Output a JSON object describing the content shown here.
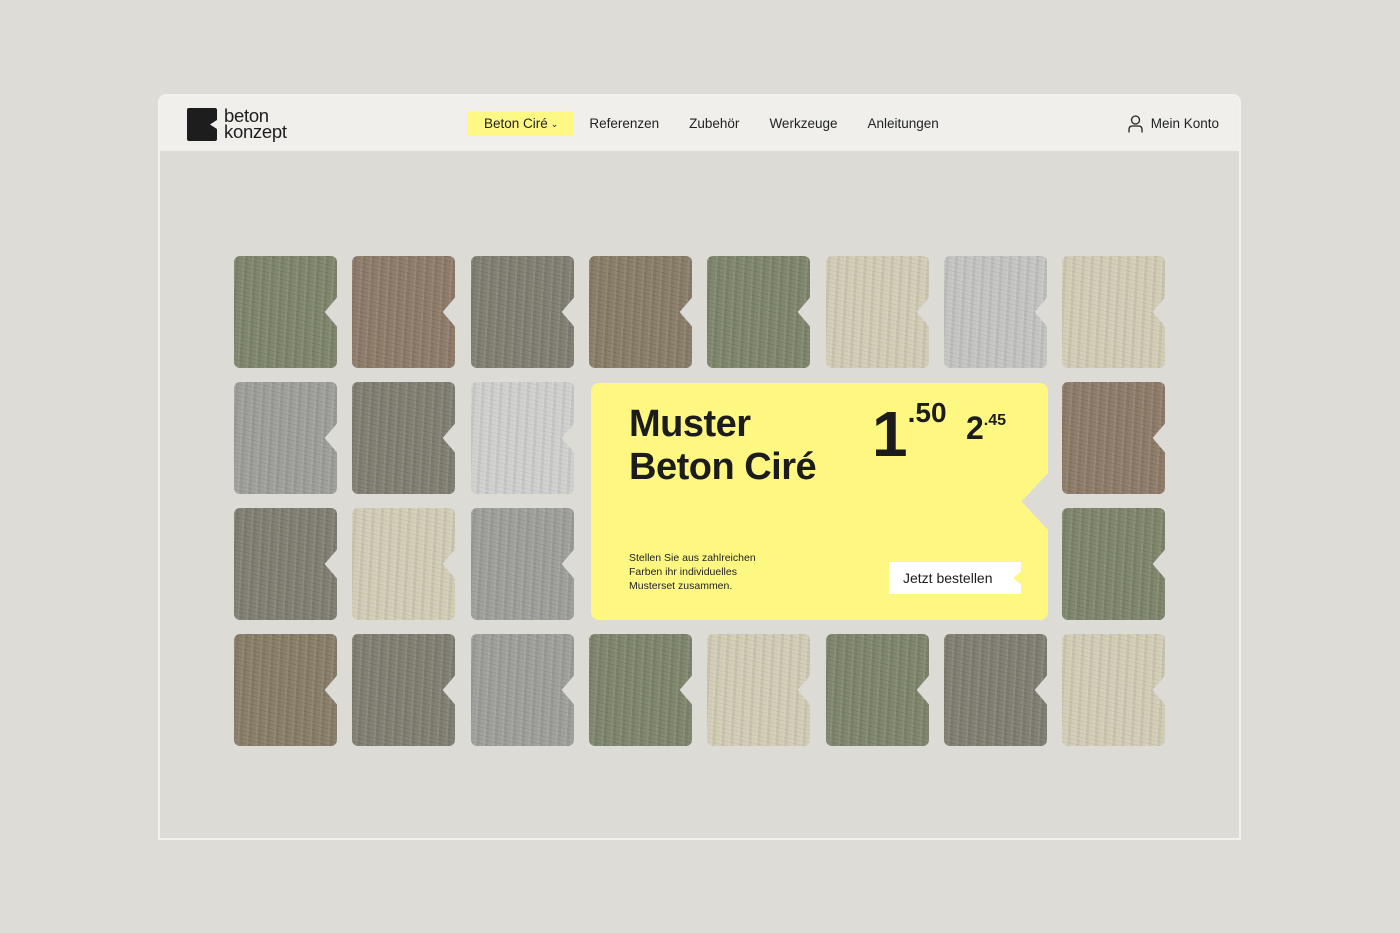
{
  "logo": {
    "line1": "beton",
    "line2": "konzept"
  },
  "nav": {
    "items": [
      {
        "label": "Beton Ciré",
        "active": true,
        "dropdown": true
      },
      {
        "label": "Referenzen"
      },
      {
        "label": "Zubehör"
      },
      {
        "label": "Werkzeuge"
      },
      {
        "label": "Anleitungen"
      }
    ],
    "account_label": "Mein Konto"
  },
  "promo": {
    "title_line1": "Muster",
    "title_line2": "Beton Ciré",
    "price_main_int": "1",
    "price_main_dec": ".50",
    "price_alt_int": "2",
    "price_alt_dec": ".45",
    "description_line1": "Stellen Sie aus zahlreichen",
    "description_line2": "Farben ihr individuelles",
    "description_line3": "Musterset zusammen.",
    "button_label": "Jetzt bestellen"
  },
  "swatches": [
    [
      "olive-green",
      "taupe-brown",
      "warm-grey",
      "khaki-brown",
      "olive-green",
      "sand-beige",
      "light-grey",
      "sand-beige"
    ],
    [
      "mid-grey",
      "warm-grey",
      "white-grey",
      null,
      null,
      null,
      null,
      "taupe-brown"
    ],
    [
      "warm-grey",
      "sand-beige",
      "mid-grey",
      null,
      null,
      null,
      null,
      "olive-green"
    ],
    [
      "khaki-brown",
      "warm-grey",
      "mid-grey",
      "olive-green",
      "sand-beige",
      "olive-green",
      "warm-grey",
      "sand-beige"
    ]
  ],
  "swatch_colors": {
    "olive-green": "#7b8368",
    "taupe-brown": "#8b7865",
    "warm-grey": "#7e7b6f",
    "khaki-brown": "#857a64",
    "sand-beige": "#d2ccb4",
    "light-grey": "#c3c3c1",
    "mid-grey": "#9c9d99",
    "white-grey": "#cfcfcd"
  },
  "colors": {
    "accent": "#fef883",
    "page_bg": "#dddcd7",
    "nav_bg": "#f0efec"
  }
}
